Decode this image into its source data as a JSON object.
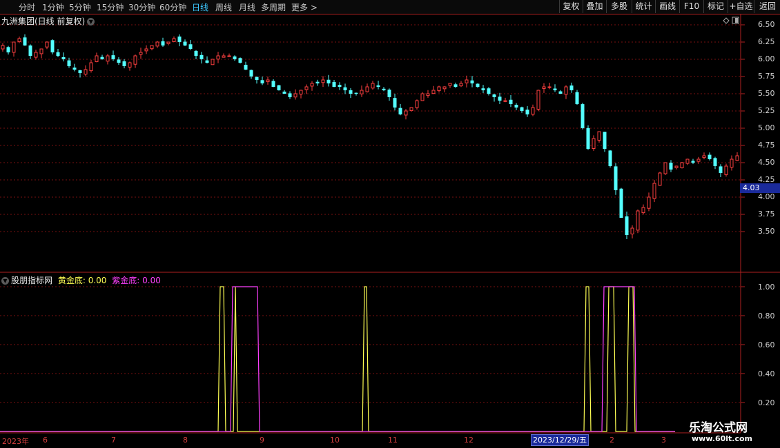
{
  "toolbar": {
    "periods": [
      "分时",
      "1分钟",
      "5分钟",
      "15分钟",
      "30分钟",
      "60分钟",
      "日线",
      "周线",
      "月线",
      "多周期",
      "更多 >"
    ],
    "active_period": "日线",
    "tools": [
      "复权",
      "叠加",
      "多股",
      "统计",
      "画线",
      "F10",
      "标记",
      "+自选",
      "返回"
    ]
  },
  "main_chart": {
    "title": "九洲集团(日线 前复权)",
    "y_ticks": [
      "6.50",
      "6.25",
      "6.00",
      "5.75",
      "5.50",
      "5.25",
      "5.00",
      "4.75",
      "4.50",
      "4.25",
      "4.00",
      "3.75",
      "3.50"
    ],
    "current_price": "4.03",
    "up_color": "#ff4040",
    "down_color": "#54ffff"
  },
  "indicator": {
    "name": "股朋指标网",
    "series1_label": "黄金底:",
    "series1_value": "0.00",
    "series1_color": "#ffff54",
    "series2_label": "紫金底:",
    "series2_value": "0.00",
    "series2_color": "#ff40ff",
    "y_ticks": [
      "1.00",
      "0.80",
      "0.60",
      "0.40",
      "0.20"
    ]
  },
  "x_axis": {
    "labels": [
      "2023年",
      "6",
      "7",
      "8",
      "9",
      "10",
      "11",
      "12",
      "2",
      "3"
    ],
    "cursor_date": "2023/12/29/五"
  },
  "chart_data": {
    "type": "candlestick",
    "title": "九洲集团(日线 前复权)",
    "ylim": [
      3.3,
      6.55
    ],
    "x_range": [
      "2023年",
      "3"
    ],
    "closes_approx": [
      6.2,
      6.1,
      6.25,
      6.3,
      6.2,
      6.05,
      6.1,
      6.15,
      6.25,
      6.1,
      6.05,
      6.0,
      5.9,
      5.85,
      5.8,
      5.85,
      5.95,
      6.05,
      6.0,
      6.05,
      6.0,
      5.95,
      5.9,
      5.95,
      6.05,
      6.1,
      6.15,
      6.2,
      6.25,
      6.2,
      6.25,
      6.3,
      6.25,
      6.2,
      6.15,
      6.05,
      6.0,
      5.95,
      6.0,
      6.05,
      6.05,
      6.05,
      6.0,
      5.95,
      5.85,
      5.75,
      5.7,
      5.65,
      5.7,
      5.6,
      5.55,
      5.5,
      5.45,
      5.5,
      5.55,
      5.6,
      5.65,
      5.65,
      5.7,
      5.65,
      5.6,
      5.6,
      5.55,
      5.5,
      5.5,
      5.55,
      5.6,
      5.65,
      5.6,
      5.55,
      5.45,
      5.3,
      5.2,
      5.25,
      5.3,
      5.4,
      5.5,
      5.5,
      5.55,
      5.6,
      5.6,
      5.65,
      5.6,
      5.65,
      5.7,
      5.65,
      5.6,
      5.55,
      5.5,
      5.45,
      5.4,
      5.4,
      5.35,
      5.3,
      5.25,
      5.2,
      5.3,
      5.55,
      5.6,
      5.6,
      5.55,
      5.5,
      5.6,
      5.55,
      5.35,
      5.0,
      4.7,
      4.85,
      4.95,
      4.7,
      4.45,
      4.1,
      3.7,
      3.45,
      3.55,
      3.8,
      3.85,
      4.0,
      4.2,
      4.35,
      4.5,
      4.4,
      4.45,
      4.5,
      4.55,
      4.5,
      4.55,
      4.6,
      4.55,
      4.45,
      4.35,
      4.45,
      4.55,
      4.6
    ],
    "indicator_series": [
      {
        "name": "黄金底",
        "pulses": [
          [
            316,
            327
          ],
          [
            338,
            344
          ],
          [
            525,
            534
          ],
          [
            846,
            856
          ],
          [
            879,
            892
          ],
          [
            908,
            920
          ]
        ]
      },
      {
        "name": "紫金底",
        "pulses": [
          [
            334,
            376
          ],
          [
            872,
            922
          ]
        ]
      }
    ]
  }
}
